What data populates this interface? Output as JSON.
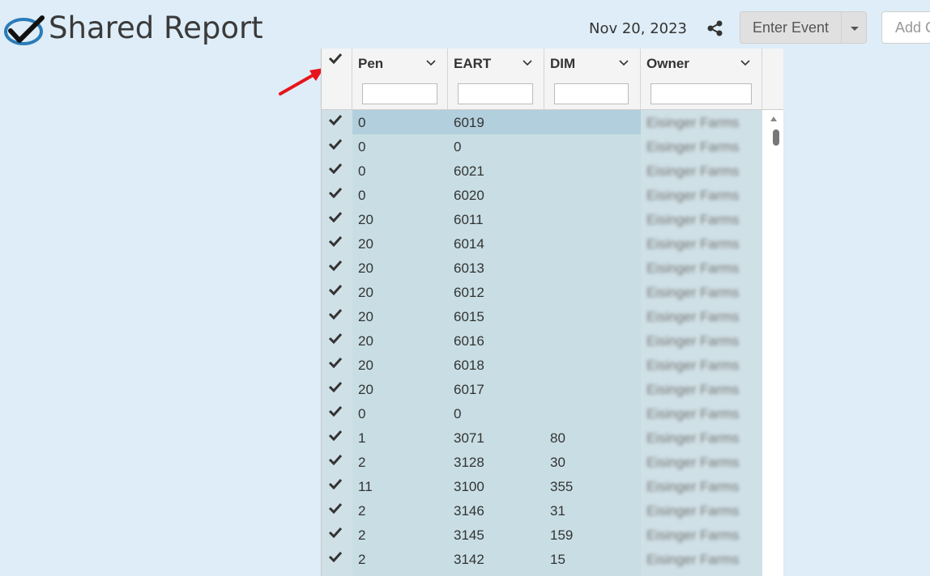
{
  "header": {
    "title": "Shared Report",
    "date": "Nov 20, 2023",
    "enter_event_label": "Enter Event",
    "add_label": "Add C"
  },
  "colors": {
    "accent": "#2b7bb9",
    "arrow": "#e8141b",
    "selected_row": "#b2cfdd"
  },
  "icons": {
    "logo": "check-circle-logo",
    "share": "share-icon",
    "dropdown": "chevron-down-icon",
    "check": "checkmark-icon"
  },
  "grid": {
    "columns": [
      {
        "key": "pen",
        "label": "Pen"
      },
      {
        "key": "eart",
        "label": "EART"
      },
      {
        "key": "dim",
        "label": "DIM"
      },
      {
        "key": "owner",
        "label": "Owner"
      }
    ],
    "rows": [
      {
        "pen": "0",
        "eart": "6019",
        "dim": "",
        "owner": "Eisinger Farms",
        "selected": true
      },
      {
        "pen": "0",
        "eart": "0",
        "dim": "",
        "owner": "Eisinger Farms"
      },
      {
        "pen": "0",
        "eart": "6021",
        "dim": "",
        "owner": "Eisinger Farms"
      },
      {
        "pen": "0",
        "eart": "6020",
        "dim": "",
        "owner": "Eisinger Farms"
      },
      {
        "pen": "20",
        "eart": "6011",
        "dim": "",
        "owner": "Eisinger Farms"
      },
      {
        "pen": "20",
        "eart": "6014",
        "dim": "",
        "owner": "Eisinger Farms"
      },
      {
        "pen": "20",
        "eart": "6013",
        "dim": "",
        "owner": "Eisinger Farms"
      },
      {
        "pen": "20",
        "eart": "6012",
        "dim": "",
        "owner": "Eisinger Farms"
      },
      {
        "pen": "20",
        "eart": "6015",
        "dim": "",
        "owner": "Eisinger Farms"
      },
      {
        "pen": "20",
        "eart": "6016",
        "dim": "",
        "owner": "Eisinger Farms"
      },
      {
        "pen": "20",
        "eart": "6018",
        "dim": "",
        "owner": "Eisinger Farms"
      },
      {
        "pen": "20",
        "eart": "6017",
        "dim": "",
        "owner": "Eisinger Farms"
      },
      {
        "pen": "0",
        "eart": "0",
        "dim": "",
        "owner": "Eisinger Farms"
      },
      {
        "pen": "1",
        "eart": "3071",
        "dim": "80",
        "owner": "Eisinger Farms"
      },
      {
        "pen": "2",
        "eart": "3128",
        "dim": "30",
        "owner": "Eisinger Farms"
      },
      {
        "pen": "11",
        "eart": "3100",
        "dim": "355",
        "owner": "Eisinger Farms"
      },
      {
        "pen": "2",
        "eart": "3146",
        "dim": "31",
        "owner": "Eisinger Farms"
      },
      {
        "pen": "2",
        "eart": "3145",
        "dim": "159",
        "owner": "Eisinger Farms"
      },
      {
        "pen": "2",
        "eart": "3142",
        "dim": "15",
        "owner": "Eisinger Farms"
      },
      {
        "pen": "",
        "eart": "",
        "dim": "",
        "owner": ""
      }
    ]
  }
}
